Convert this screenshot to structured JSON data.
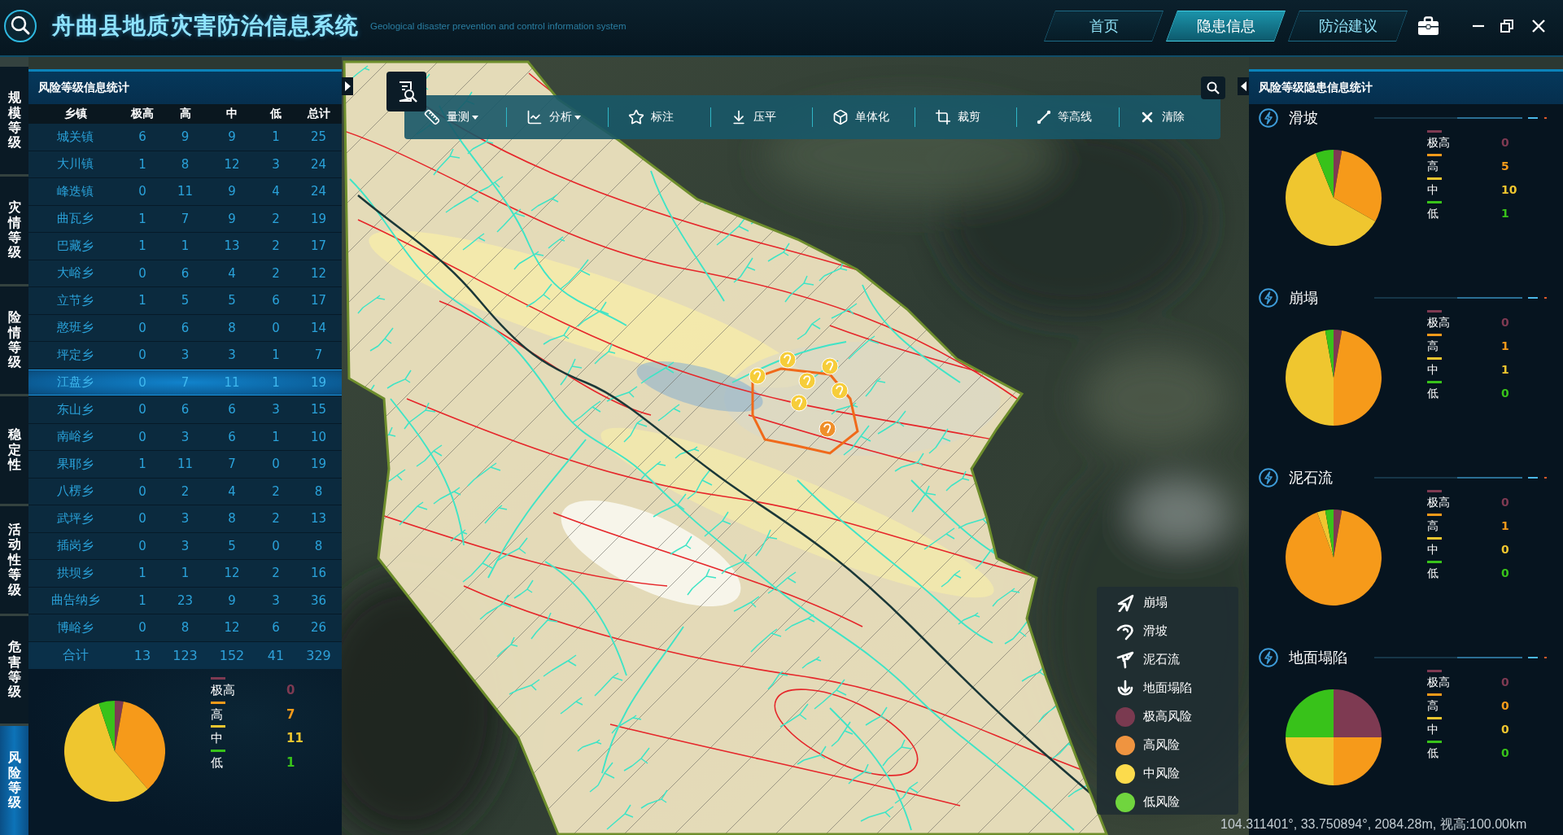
{
  "header": {
    "title": "舟曲县地质灾害防治信息系统",
    "subtitle": "Geological disaster prevention and control information system"
  },
  "nav": [
    {
      "label": "首页",
      "selected": false
    },
    {
      "label": "隐患信息",
      "selected": true
    },
    {
      "label": "防治建议",
      "selected": false
    }
  ],
  "side_tabs": [
    {
      "label": "规模等级",
      "selected": false
    },
    {
      "label": "灾情等级",
      "selected": false
    },
    {
      "label": "险情等级",
      "selected": false
    },
    {
      "label": "稳定性",
      "selected": false
    },
    {
      "label": "活动性等级",
      "selected": false
    },
    {
      "label": "危害等级",
      "selected": false
    },
    {
      "label": "风险等级",
      "selected": true
    }
  ],
  "left_panel": {
    "title": "风险等级信息统计",
    "table": {
      "columns": [
        "乡镇",
        "极高",
        "高",
        "中",
        "低",
        "总计"
      ],
      "rows": [
        {
          "cells": [
            "城关镇",
            "6",
            "9",
            "9",
            "1",
            "25"
          ],
          "selected": false
        },
        {
          "cells": [
            "大川镇",
            "1",
            "8",
            "12",
            "3",
            "24"
          ],
          "selected": false
        },
        {
          "cells": [
            "峰迭镇",
            "0",
            "11",
            "9",
            "4",
            "24"
          ],
          "selected": false
        },
        {
          "cells": [
            "曲瓦乡",
            "1",
            "7",
            "9",
            "2",
            "19"
          ],
          "selected": false
        },
        {
          "cells": [
            "巴藏乡",
            "1",
            "1",
            "13",
            "2",
            "17"
          ],
          "selected": false
        },
        {
          "cells": [
            "大峪乡",
            "0",
            "6",
            "4",
            "2",
            "12"
          ],
          "selected": false
        },
        {
          "cells": [
            "立节乡",
            "1",
            "5",
            "5",
            "6",
            "17"
          ],
          "selected": false
        },
        {
          "cells": [
            "憨班乡",
            "0",
            "6",
            "8",
            "0",
            "14"
          ],
          "selected": false
        },
        {
          "cells": [
            "坪定乡",
            "0",
            "3",
            "3",
            "1",
            "7"
          ],
          "selected": false
        },
        {
          "cells": [
            "江盘乡",
            "0",
            "7",
            "11",
            "1",
            "19"
          ],
          "selected": true
        },
        {
          "cells": [
            "东山乡",
            "0",
            "6",
            "6",
            "3",
            "15"
          ],
          "selected": false
        },
        {
          "cells": [
            "南峪乡",
            "0",
            "3",
            "6",
            "1",
            "10"
          ],
          "selected": false
        },
        {
          "cells": [
            "果耶乡",
            "1",
            "11",
            "7",
            "0",
            "19"
          ],
          "selected": false
        },
        {
          "cells": [
            "八楞乡",
            "0",
            "2",
            "4",
            "2",
            "8"
          ],
          "selected": false
        },
        {
          "cells": [
            "武坪乡",
            "0",
            "3",
            "8",
            "2",
            "13"
          ],
          "selected": false
        },
        {
          "cells": [
            "插岗乡",
            "0",
            "3",
            "5",
            "0",
            "8"
          ],
          "selected": false
        },
        {
          "cells": [
            "拱坝乡",
            "1",
            "1",
            "12",
            "2",
            "16"
          ],
          "selected": false
        },
        {
          "cells": [
            "曲告纳乡",
            "1",
            "23",
            "9",
            "3",
            "36"
          ],
          "selected": false
        },
        {
          "cells": [
            "博峪乡",
            "0",
            "8",
            "12",
            "6",
            "26"
          ],
          "selected": false
        }
      ],
      "total": [
        "合计",
        "13",
        "123",
        "152",
        "41",
        "329"
      ]
    },
    "chart": {
      "legend": [
        {
          "value": "0",
          "color": "#7e3a52"
        },
        {
          "value": "7",
          "color": "#f69a1a"
        },
        {
          "value": "11",
          "color": "#efc62f"
        },
        {
          "value": "1",
          "color": "#38c21a"
        }
      ],
      "chart_data": {
        "type": "pie",
        "categories": [
          "极高",
          "高",
          "中",
          "低"
        ],
        "values": [
          2.78,
          35.82,
          56.28,
          5.12
        ]
      }
    }
  },
  "map": {
    "toolbar": [
      {
        "label": "量测",
        "dropdown": true
      },
      {
        "label": "分析",
        "dropdown": true
      },
      {
        "label": "标注",
        "dropdown": false
      },
      {
        "label": "压平",
        "dropdown": false
      },
      {
        "label": "单体化",
        "dropdown": false
      },
      {
        "label": "裁剪",
        "dropdown": false
      },
      {
        "label": "等高线",
        "dropdown": false
      },
      {
        "label": "清除",
        "dropdown": false
      }
    ],
    "legend": [
      {
        "kind": "symbol",
        "label": "崩塌"
      },
      {
        "kind": "symbol",
        "label": "滑坡"
      },
      {
        "kind": "symbol",
        "label": "泥石流"
      },
      {
        "kind": "symbol",
        "label": "地面塌陷"
      },
      {
        "kind": "dot",
        "label": "极高风险",
        "color": "#7a3a50"
      },
      {
        "kind": "dot",
        "label": "高风险",
        "color": "#ef9440"
      },
      {
        "kind": "dot",
        "label": "中风险",
        "color": "#fcdb4c"
      },
      {
        "kind": "dot",
        "label": "低风险",
        "color": "#70d53e"
      }
    ],
    "coordinates": "104.311401°, 33.750894°, 2084.28m, 视高:100.00km"
  },
  "right_panel": {
    "title": "风险等级隐患信息统计",
    "sections": [
      {
        "title": "滑坡",
        "legend": [
          {
            "value": "0",
            "color": "#7e3a52"
          },
          {
            "value": "5",
            "color": "#f69a1a"
          },
          {
            "value": "10",
            "color": "#efc62f"
          },
          {
            "value": "1",
            "color": "#38c21a"
          }
        ],
        "chart_data": {
          "type": "pie",
          "categories": [
            "极高",
            "高",
            "中",
            "低"
          ],
          "values": [
            2.78,
            30.38,
            60.76,
            6.08
          ]
        }
      },
      {
        "title": "崩塌",
        "legend": [
          {
            "value": "0",
            "color": "#7e3a52"
          },
          {
            "value": "1",
            "color": "#f69a1a"
          },
          {
            "value": "1",
            "color": "#efc62f"
          },
          {
            "value": "0",
            "color": "#38c21a"
          }
        ],
        "chart_data": {
          "type": "pie",
          "categories": [
            "极高",
            "高",
            "中",
            "低"
          ],
          "values": [
            2.78,
            47.22,
            47.22,
            2.78
          ]
        }
      },
      {
        "title": "泥石流",
        "legend": [
          {
            "value": "0",
            "color": "#7e3a52"
          },
          {
            "value": "1",
            "color": "#f69a1a"
          },
          {
            "value": "0",
            "color": "#efc62f"
          },
          {
            "value": "0",
            "color": "#38c21a"
          }
        ],
        "chart_data": {
          "type": "pie",
          "categories": [
            "极高",
            "高",
            "中",
            "低"
          ],
          "values": [
            2.78,
            91.66,
            2.78,
            2.78
          ]
        }
      },
      {
        "title": "地面塌陷",
        "legend": [
          {
            "value": "0",
            "color": "#7e3a52"
          },
          {
            "value": "0",
            "color": "#f69a1a"
          },
          {
            "value": "0",
            "color": "#efc62f"
          },
          {
            "value": "0",
            "color": "#38c21a"
          }
        ],
        "chart_data": {
          "type": "pie",
          "categories": [
            "极高",
            "高",
            "中",
            "低"
          ],
          "values": [
            25,
            25,
            25,
            25
          ]
        }
      }
    ]
  }
}
